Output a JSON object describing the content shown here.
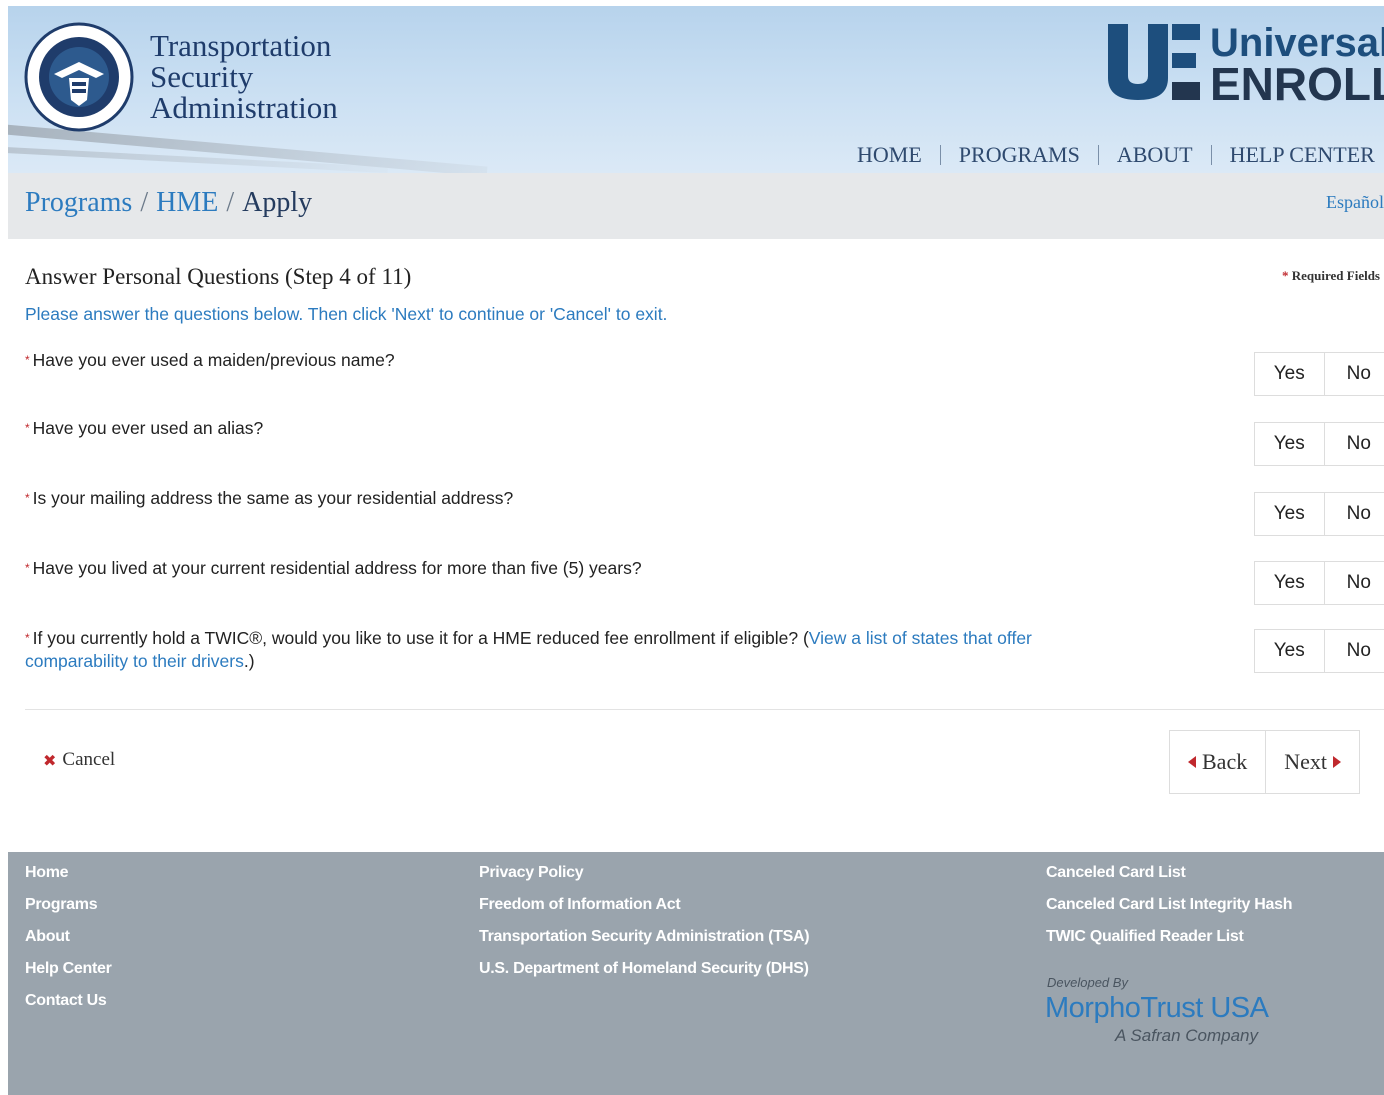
{
  "header": {
    "tsa_line1": "Transportation",
    "tsa_line2": "Security",
    "tsa_line3": "Administration",
    "ue_line1": "Universal",
    "ue_line2": "ENROLL",
    "nav": [
      "HOME",
      "PROGRAMS",
      "ABOUT",
      "HELP CENTER"
    ]
  },
  "breadcrumb": {
    "items": [
      "Programs",
      "HME",
      "Apply"
    ],
    "language_link": "Español"
  },
  "main": {
    "step_title": "Answer Personal Questions (Step 4 of 11)",
    "required_note": "Required Fields",
    "instructions": "Please answer the questions below. Then click 'Next' to continue or 'Cancel' to exit.",
    "questions": [
      {
        "text": "Have you ever used a maiden/previous name?"
      },
      {
        "text": "Have you ever used an alias?"
      },
      {
        "text": "Is your mailing address the same as your residential address?"
      },
      {
        "text": "Have you lived at your current residential address for more than five (5) years?"
      },
      {
        "text": "If you currently hold a TWIC®, would you like to use it for a HME reduced fee enrollment if eligible? (",
        "link": "View a list of states that offer comparability to their drivers",
        "after": ".)"
      }
    ],
    "yes_label": "Yes",
    "no_label": "No",
    "cancel_label": "Cancel",
    "back_label": "Back",
    "next_label": "Next"
  },
  "footer": {
    "col1": [
      "Home",
      "Programs",
      "About",
      "Help Center",
      "Contact Us"
    ],
    "col2": [
      "Privacy Policy",
      "Freedom of Information Act",
      "Transportation Security Administration (TSA)",
      "U.S. Department of Homeland Security (DHS)"
    ],
    "col3": [
      "Canceled Card List",
      "Canceled Card List Integrity Hash",
      "TWIC Qualified Reader List"
    ],
    "developed_by": "Developed By",
    "developer": "MorphoTrust USA",
    "developer_tagline": "A Safran Company"
  },
  "colors": {
    "brand_blue": "#2c7bbf",
    "navy": "#1f3c6b",
    "required_red": "#c0282d",
    "footer_gray": "#9aa4ad"
  }
}
